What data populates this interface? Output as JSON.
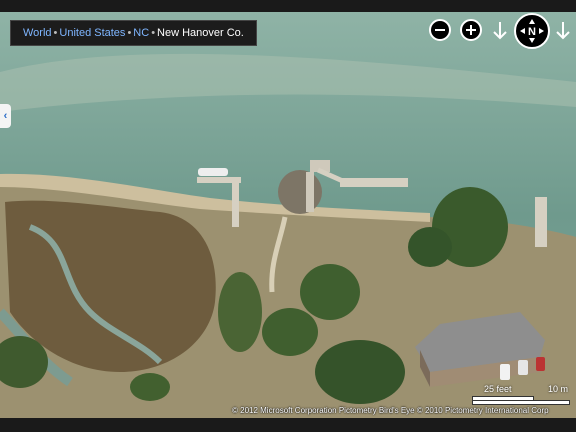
{
  "breadcrumb": {
    "items": [
      {
        "label": "World",
        "link": true
      },
      {
        "label": "United States",
        "link": true
      },
      {
        "label": "NC",
        "link": true
      },
      {
        "label": "New Hanover Co.",
        "link": false
      }
    ],
    "separator": "•"
  },
  "controls": {
    "zoom_out_icon": "minus-icon",
    "zoom_in_icon": "plus-icon",
    "rotate_left_icon": "arrow-down-icon",
    "compass_label": "N",
    "rotate_right_icon": "arrow-down-icon"
  },
  "side_panel": {
    "toggle_glyph": "‹"
  },
  "scale": {
    "feet_label": "25 feet",
    "meters_label": "10 m"
  },
  "copyright": "© 2012 Microsoft Corporation   Pictometry Bird's Eye © 2010 Pictometry International Corp",
  "colors": {
    "water": "#7ea599",
    "water_deep": "#6e968b",
    "sand": "#c9bd9f",
    "marsh": "#6b5a3e",
    "grass": "#9a8a64",
    "tree": "#3f5f2f",
    "roof": "#8c8c8c",
    "link": "#7fb6ff"
  }
}
